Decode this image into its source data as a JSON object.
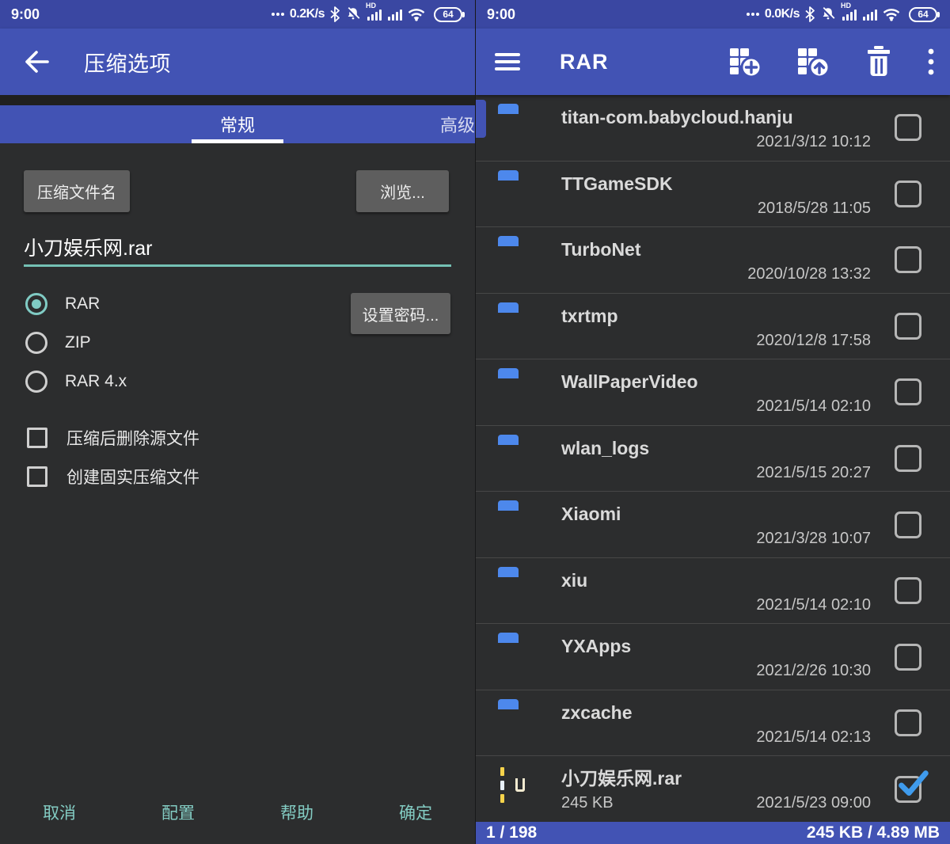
{
  "colors": {
    "statusbar": "#3a47a2",
    "toolbar": "#4253b4",
    "bg": "#2c2d2e",
    "accent": "#80cbc4",
    "check": "#3f9bed",
    "folder_blue": "#57a9f4"
  },
  "left": {
    "status": {
      "time": "9:00",
      "speed": "0.2K/s",
      "hd": "HD",
      "battery": "64"
    },
    "toolbar": {
      "title": "压缩选项"
    },
    "tabs": [
      {
        "label": "常规",
        "active": true
      },
      {
        "label": "高级",
        "active": false
      }
    ],
    "form": {
      "archive_name_button": "压缩文件名",
      "browse_button": "浏览...",
      "filename": "小刀娱乐网.rar",
      "set_password_button": "设置密码...",
      "formats": [
        {
          "label": "RAR",
          "selected": true
        },
        {
          "label": "ZIP",
          "selected": false
        },
        {
          "label": "RAR 4.x",
          "selected": false
        }
      ],
      "checkboxes": [
        {
          "label": "压缩后删除源文件",
          "checked": false
        },
        {
          "label": "创建固实压缩文件",
          "checked": false
        }
      ]
    },
    "actions": {
      "cancel": "取消",
      "profiles": "配置",
      "help": "帮助",
      "ok": "确定"
    }
  },
  "right": {
    "status": {
      "time": "9:00",
      "speed": "0.0K/s",
      "hd": "HD",
      "battery": "64"
    },
    "toolbar": {
      "title": "RAR"
    },
    "files": [
      {
        "name": "titan-com.babycloud.hanju",
        "date": "2021/3/12 10:12",
        "type": "folder",
        "checked": false
      },
      {
        "name": "TTGameSDK",
        "date": "2018/5/28 11:05",
        "type": "folder",
        "checked": false
      },
      {
        "name": "TurboNet",
        "date": "2020/10/28 13:32",
        "type": "folder",
        "checked": false
      },
      {
        "name": "txrtmp",
        "date": "2020/12/8 17:58",
        "type": "folder",
        "checked": false
      },
      {
        "name": "WallPaperVideo",
        "date": "2021/5/14 02:10",
        "type": "folder",
        "checked": false
      },
      {
        "name": "wlan_logs",
        "date": "2021/5/15 20:27",
        "type": "folder",
        "checked": false
      },
      {
        "name": "Xiaomi",
        "date": "2021/3/28 10:07",
        "type": "folder",
        "checked": false
      },
      {
        "name": "xiu",
        "date": "2021/5/14 02:10",
        "type": "folder",
        "checked": false
      },
      {
        "name": "YXApps",
        "date": "2021/2/26 10:30",
        "type": "folder",
        "checked": false
      },
      {
        "name": "zxcache",
        "date": "2021/5/14 02:13",
        "type": "folder",
        "checked": false
      },
      {
        "name": "小刀娱乐网.rar",
        "size": "245 KB",
        "date": "2021/5/23 09:00",
        "type": "rar",
        "checked": true
      }
    ],
    "statusbar": {
      "position": "1 / 198",
      "size_summary": "245 KB / 4.89 MB"
    }
  }
}
